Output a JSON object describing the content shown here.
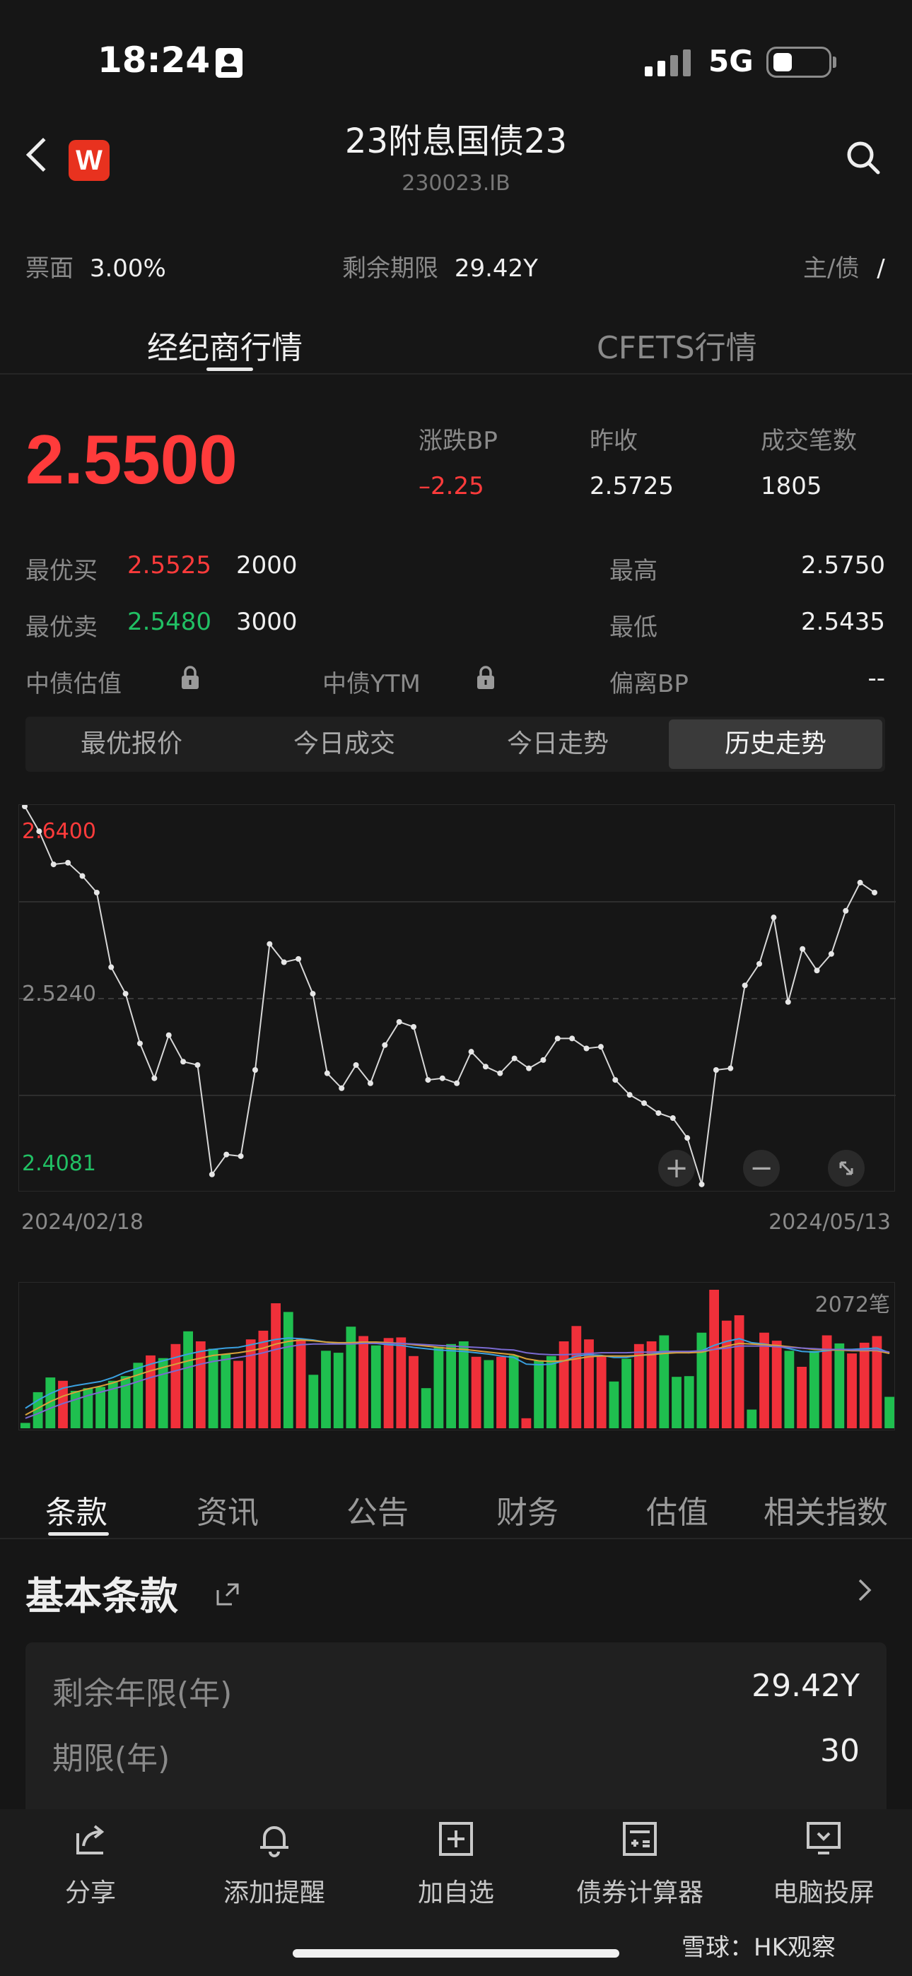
{
  "status": {
    "time": "18:24",
    "network": "5G"
  },
  "header": {
    "title": "23附息国债23",
    "code": "230023.IB"
  },
  "info": {
    "coupon_label": "票面",
    "coupon_value": "3.00%",
    "term_label": "剩余期限",
    "term_value": "29.42Y",
    "type_label": "主/债",
    "type_sep": "/"
  },
  "top_tabs": {
    "broker": "经纪商行情",
    "cfets": "CFETS行情"
  },
  "quote": {
    "price": "2.5500",
    "change_label": "涨跌BP",
    "change_value": "–2.25",
    "prev_label": "昨收",
    "prev_value": "2.5725",
    "count_label": "成交笔数",
    "count_value": "1805"
  },
  "depth": {
    "bid_label": "最优买",
    "bid_price": "2.5525",
    "bid_qty": "2000",
    "ask_label": "最优卖",
    "ask_price": "2.5480",
    "ask_qty": "3000",
    "high_label": "最高",
    "high_value": "2.5750",
    "low_label": "最低",
    "low_value": "2.5435",
    "val_label": "中债估值",
    "ytm_label": "中债YTM",
    "dev_label": "偏离BP",
    "dev_value": "--"
  },
  "segments": [
    "最优报价",
    "今日成交",
    "今日走势",
    "历史走势"
  ],
  "chart_data": {
    "type": "line",
    "y_labels": {
      "high": "2.6400",
      "mid": "2.5240",
      "low": "2.4081"
    },
    "x_labels": {
      "start": "2024/02/18",
      "end": "2024/05/13"
    },
    "ylim": [
      2.4081,
      2.64
    ],
    "values": [
      2.64,
      2.625,
      2.605,
      2.606,
      2.598,
      2.588,
      2.543,
      2.527,
      2.497,
      2.476,
      2.502,
      2.486,
      2.484,
      2.418,
      2.43,
      2.429,
      2.481,
      2.557,
      2.546,
      2.548,
      2.527,
      2.479,
      2.47,
      2.484,
      2.473,
      2.496,
      2.51,
      2.507,
      2.475,
      2.476,
      2.473,
      2.492,
      2.483,
      2.479,
      2.488,
      2.482,
      2.487,
      2.5,
      2.5,
      2.494,
      2.495,
      2.475,
      2.466,
      2.461,
      2.455,
      2.452,
      2.44,
      2.412,
      2.481,
      2.482,
      2.532,
      2.545,
      2.573,
      2.522,
      2.554,
      2.541,
      2.551,
      2.577,
      2.594,
      2.588
    ]
  },
  "volume_data": {
    "type": "bar",
    "max_label": "2072笔",
    "values": [
      80,
      540,
      760,
      710,
      560,
      600,
      620,
      710,
      780,
      980,
      1090,
      1050,
      1260,
      1450,
      1300,
      1190,
      1110,
      1010,
      1330,
      1460,
      1870,
      1740,
      1340,
      800,
      1160,
      1130,
      1520,
      1380,
      1240,
      1350,
      1360,
      1080,
      600,
      1220,
      1260,
      1300,
      1070,
      1020,
      1070,
      1090,
      150,
      1010,
      1080,
      1300,
      1530,
      1330,
      1090,
      700,
      1040,
      1260,
      1300,
      1390,
      770,
      780,
      1430,
      2072,
      1610,
      1690,
      280,
      1430,
      1310,
      1160,
      920,
      1160,
      1390,
      1270,
      1120,
      1280,
      1380,
      470
    ],
    "colors": [
      "g",
      "g",
      "g",
      "r",
      "g",
      "g",
      "g",
      "g",
      "g",
      "g",
      "r",
      "g",
      "r",
      "g",
      "r",
      "g",
      "g",
      "r",
      "r",
      "r",
      "r",
      "g",
      "r",
      "g",
      "g",
      "g",
      "g",
      "r",
      "g",
      "r",
      "r",
      "r",
      "g",
      "g",
      "g",
      "g",
      "r",
      "g",
      "r",
      "g",
      "r",
      "g",
      "g",
      "r",
      "r",
      "r",
      "r",
      "g",
      "g",
      "r",
      "r",
      "g",
      "g",
      "g",
      "g",
      "r",
      "r",
      "r",
      "g",
      "r",
      "r",
      "g",
      "r",
      "g",
      "r",
      "g",
      "r",
      "r",
      "r",
      "g"
    ],
    "ma1": [
      300,
      420,
      520,
      600,
      640,
      670,
      700,
      760,
      840,
      900,
      960,
      1010,
      1060,
      1110,
      1150,
      1180,
      1200,
      1210,
      1250,
      1290,
      1330,
      1350,
      1340,
      1320,
      1290,
      1270,
      1280,
      1290,
      1270,
      1250,
      1240,
      1210,
      1190,
      1170,
      1160,
      1150,
      1130,
      1110,
      1080,
      1060,
      960,
      950,
      960,
      1010,
      1080,
      1100,
      1090,
      1060,
      1060,
      1090,
      1110,
      1140,
      1140,
      1130,
      1160,
      1240,
      1300,
      1340,
      1280,
      1260,
      1230,
      1190,
      1150,
      1140,
      1160,
      1180,
      1180,
      1190,
      1200,
      1130
    ],
    "ma2": [
      200,
      300,
      400,
      480,
      540,
      590,
      630,
      680,
      740,
      800,
      860,
      910,
      960,
      1010,
      1050,
      1090,
      1110,
      1130,
      1160,
      1200,
      1260,
      1300,
      1320,
      1310,
      1290,
      1280,
      1280,
      1290,
      1290,
      1280,
      1270,
      1250,
      1230,
      1210,
      1190,
      1180,
      1160,
      1140,
      1120,
      1100,
      1040,
      1010,
      1000,
      1010,
      1040,
      1070,
      1080,
      1080,
      1080,
      1090,
      1100,
      1120,
      1130,
      1130,
      1140,
      1180,
      1230,
      1270,
      1260,
      1250,
      1240,
      1220,
      1200,
      1180,
      1170,
      1170,
      1160,
      1160,
      1160,
      1120
    ],
    "ma3": [
      150,
      220,
      300,
      370,
      430,
      490,
      540,
      590,
      640,
      700,
      760,
      810,
      860,
      910,
      960,
      1000,
      1030,
      1060,
      1090,
      1130,
      1180,
      1220,
      1250,
      1260,
      1260,
      1260,
      1260,
      1270,
      1270,
      1270,
      1270,
      1260,
      1250,
      1240,
      1230,
      1220,
      1210,
      1200,
      1180,
      1170,
      1130,
      1110,
      1100,
      1100,
      1110,
      1120,
      1130,
      1130,
      1130,
      1140,
      1140,
      1150,
      1150,
      1150,
      1160,
      1180,
      1200,
      1230,
      1230,
      1230,
      1220,
      1210,
      1200,
      1190,
      1180,
      1180,
      1170,
      1170,
      1170,
      1140
    ]
  },
  "lower_tabs": [
    "条款",
    "资讯",
    "公告",
    "财务",
    "估值",
    "相关指数"
  ],
  "terms": {
    "title": "基本条款",
    "rows": [
      {
        "label": "剩余年限(年)",
        "value": "29.42Y"
      },
      {
        "label": "期限(年)",
        "value": "30"
      }
    ]
  },
  "bottom_bar": [
    "分享",
    "添加提醒",
    "加自选",
    "债券计算器",
    "电脑投屏"
  ],
  "watermark": "雪球：HK观察",
  "colors": {
    "red": "#ff3b3b",
    "green": "#21c064",
    "bg": "#161616"
  }
}
